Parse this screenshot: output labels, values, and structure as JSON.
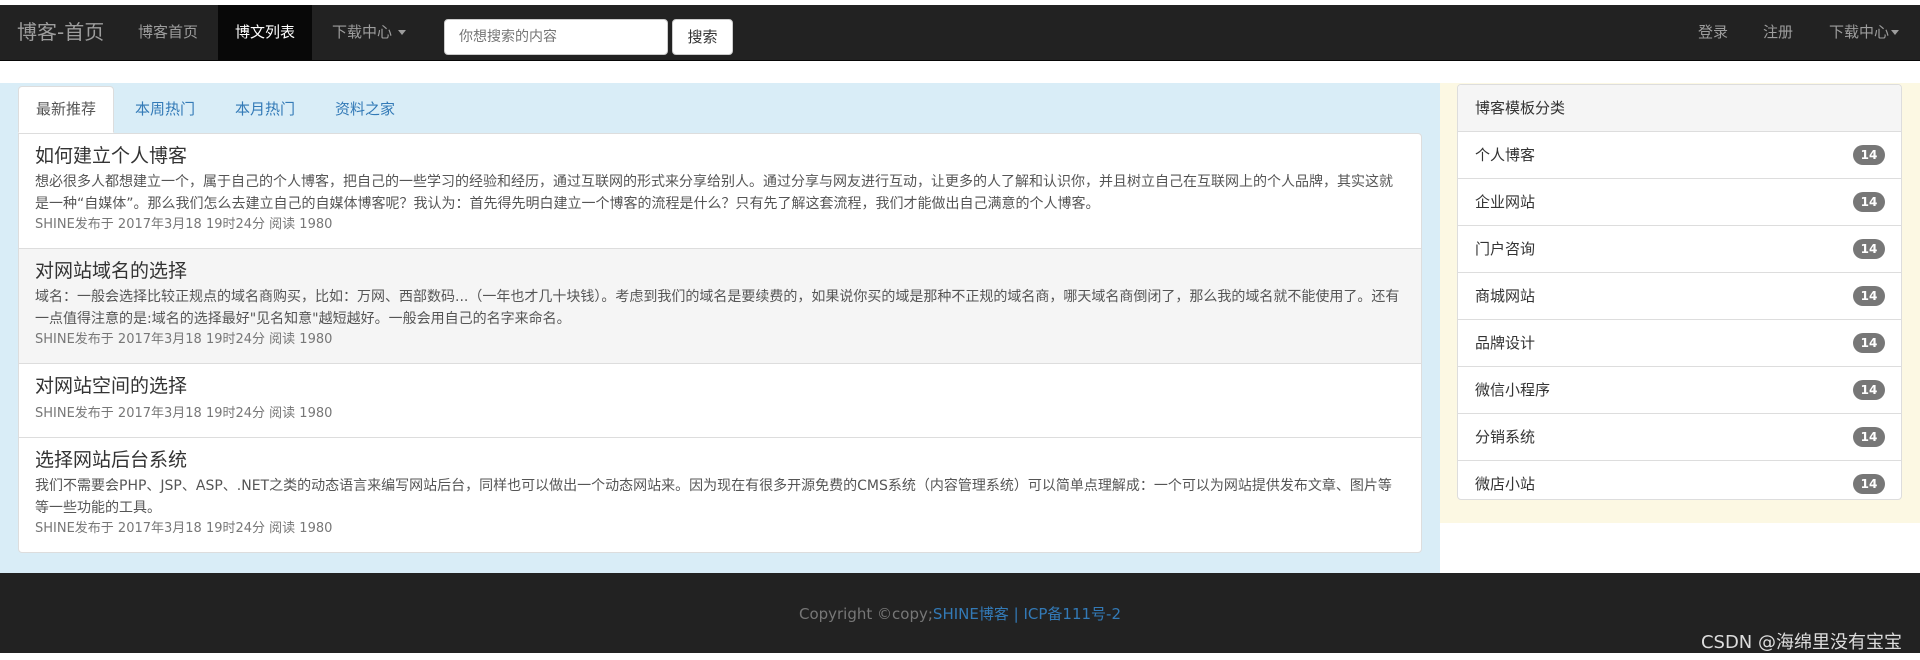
{
  "navbar": {
    "brand": "博客-首页",
    "items": [
      {
        "label": "博客首页",
        "active": false
      },
      {
        "label": "博文列表",
        "active": true
      },
      {
        "label": "下载中心",
        "active": false
      }
    ],
    "search_placeholder": "你想搜索的内容",
    "search_button": "搜索",
    "right_items": [
      {
        "label": "登录"
      },
      {
        "label": "注册"
      },
      {
        "label": "下载中心"
      }
    ]
  },
  "tabs": [
    {
      "label": "最新推荐",
      "active": true
    },
    {
      "label": "本周热门",
      "active": false
    },
    {
      "label": "本月热门",
      "active": false
    },
    {
      "label": "资料之家",
      "active": false
    }
  ],
  "articles": [
    {
      "title": "如何建立个人博客",
      "summary": "想必很多人都想建立一个，属于自己的个人博客，把自己的一些学习的经验和经历，通过互联网的形式来分享给别人。通过分享与网友进行互动，让更多的人了解和认识你，并且树立自己在互联网上的个人品牌，其实这就是一种“自媒体”。那么我们怎么去建立自己的自媒体博客呢？我认为：首先得先明白建立一个博客的流程是什么？只有先了解这套流程，我们才能做出自己满意的个人博客。",
      "meta": "SHINE发布于 2017年3月18 19时24分 阅读 1980"
    },
    {
      "title": "对网站域名的选择",
      "summary": "域名：一般会选择比较正规点的域名商购买，比如：万网、西部数码...（一年也才几十块钱）。考虑到我们的域名是要续费的，如果说你买的域是那种不正规的域名商，哪天域名商倒闭了，那么我的域名就不能使用了。还有一点值得注意的是:域名的选择最好\"见名知意\"越短越好。一般会用自己的名字来命名。",
      "meta": "SHINE发布于 2017年3月18 19时24分 阅读 1980"
    },
    {
      "title": "对网站空间的选择",
      "summary": "",
      "meta": "SHINE发布于 2017年3月18 19时24分 阅读 1980"
    },
    {
      "title": "选择网站后台系统",
      "summary": "我们不需要会PHP、JSP、ASP、.NET之类的动态语言来编写网站后台，同样也可以做出一个动态网站来。因为现在有很多开源免费的CMS系统（内容管理系统）可以简单点理解成：一个可以为网站提供发布文章、图片等等一些功能的工具。",
      "meta": "SHINE发布于 2017年3月18 19时24分 阅读 1980"
    }
  ],
  "sidebar": {
    "heading": "博客模板分类",
    "items": [
      {
        "label": "个人博客",
        "count": "14"
      },
      {
        "label": "企业网站",
        "count": "14"
      },
      {
        "label": "门户咨询",
        "count": "14"
      },
      {
        "label": "商城网站",
        "count": "14"
      },
      {
        "label": "品牌设计",
        "count": "14"
      },
      {
        "label": "微信小程序",
        "count": "14"
      },
      {
        "label": "分销系统",
        "count": "14"
      },
      {
        "label": "微店小站",
        "count": "14"
      }
    ]
  },
  "footer": {
    "copyright": "Copyright ©copy;",
    "link1": "SHINE博客",
    "separator": "|",
    "link2": "ICP备111号-2"
  },
  "watermark": "CSDN @海绵里没有宝宝",
  "colors": {
    "navbar_bg": "#222222",
    "main_left_bg": "#d9edf7",
    "main_right_bg": "#fcf8e3",
    "link": "#337ab7",
    "badge": "#777777"
  }
}
